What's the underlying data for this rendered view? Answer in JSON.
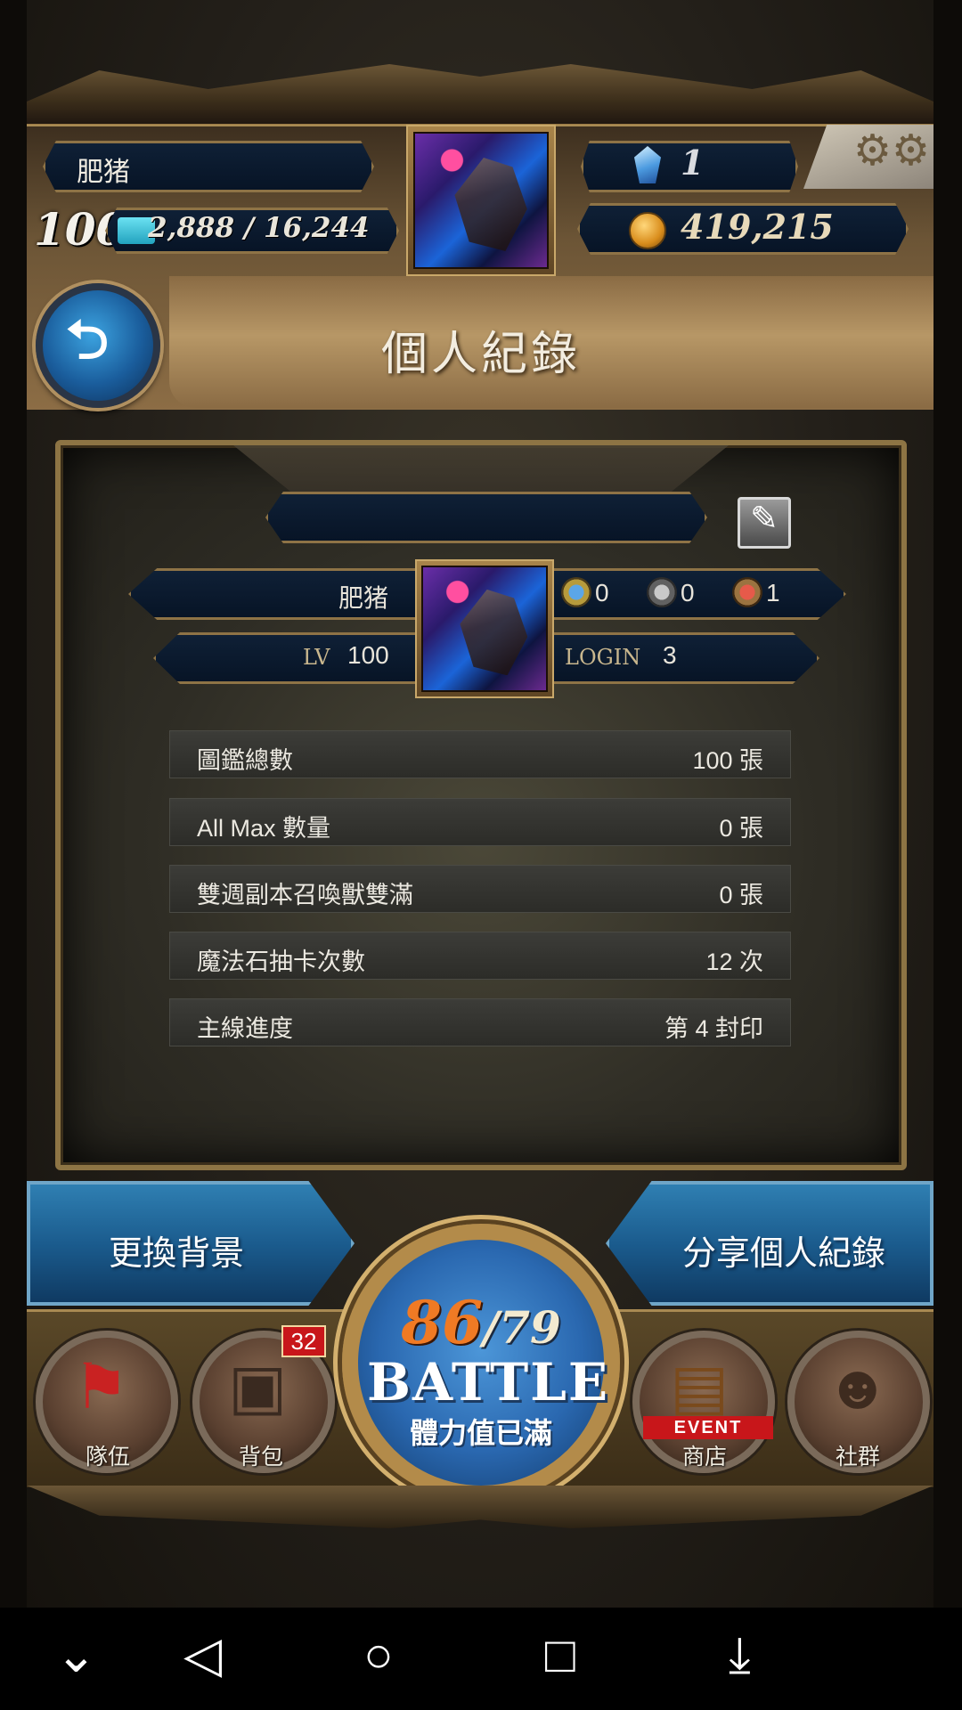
{
  "header": {
    "player_name": "肥猪",
    "level": "100",
    "exp_text": "2,888 / 16,244",
    "exp_fraction": 0.18,
    "gems": "1",
    "coins": "419,215",
    "page_title": "個人紀錄"
  },
  "profile": {
    "name": "肥猪",
    "lv_label": "LV",
    "lv_value": "100",
    "login_label": "LOGIN",
    "login_value": "3",
    "element_counts": [
      "0",
      "0",
      "1"
    ]
  },
  "stats": [
    {
      "label": "圖鑑總數",
      "value": "100 張"
    },
    {
      "label": "All Max 數量",
      "value": "0 張"
    },
    {
      "label": "雙週副本召喚獸雙滿",
      "value": "0 張"
    },
    {
      "label": "魔法石抽卡次數",
      "value": "12 次"
    },
    {
      "label": "主線進度",
      "value": "第 4 封印"
    }
  ],
  "actions": {
    "change_background": "更換背景",
    "share_record": "分享個人紀錄"
  },
  "battle": {
    "stamina_current": "86",
    "stamina_max": "/79",
    "label": "BATTLE",
    "status": "體力值已滿"
  },
  "nav": {
    "team": "隊伍",
    "bag": "背包",
    "bag_badge": "32",
    "shop": "商店",
    "shop_tag": "EVENT",
    "social": "社群"
  },
  "icons": {
    "back": "back-arrow-icon",
    "settings": "gear-icon",
    "edit": "pencil-icon",
    "gem": "gem-icon",
    "coin": "coin-icon"
  }
}
